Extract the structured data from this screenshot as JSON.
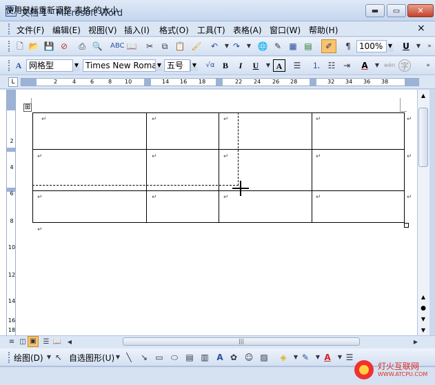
{
  "window": {
    "title": "文档 1 - Microsoft Word",
    "icon_name": "word-document-icon",
    "minimize_glyph": "▬",
    "maximize_glyph": "▭",
    "close_glyph": "✕"
  },
  "menu": {
    "items": [
      "文件(F)",
      "编辑(E)",
      "视图(V)",
      "插入(I)",
      "格式(O)",
      "工具(T)",
      "表格(A)",
      "窗口(W)",
      "帮助(H)"
    ],
    "close_glyph": "×"
  },
  "standard_toolbar": {
    "zoom_value": "100%",
    "underline_label": "U"
  },
  "format_toolbar": {
    "style_value": "网格型",
    "font_value": "Times New Roma",
    "size_value": "五号",
    "bold": "B",
    "italic": "I",
    "underline": "U",
    "char_border": "A",
    "font_color": "A",
    "phonetic": "wén",
    "enclose": "字"
  },
  "ruler": {
    "ticks": [
      "2",
      "4",
      "6",
      "8",
      "10",
      "14",
      "16",
      "18",
      "22",
      "24",
      "26",
      "28",
      "32",
      "34",
      "36",
      "38"
    ],
    "vticks": [
      "2",
      "4",
      "6",
      "8",
      "10",
      "12",
      "14",
      "16",
      "18"
    ]
  },
  "document": {
    "cell_mark": "↵",
    "paragraph_mark": "↵",
    "table_move_handle": "⊞"
  },
  "draw_toolbar": {
    "draw_label": "绘图(D)",
    "autoshape_label": "自选图形(U)"
  },
  "status": {
    "text": "使用鼠标重新调整 表格 的大小"
  },
  "watermark": {
    "text_top": "灯火互联网",
    "text_bottom": "WWW.ATCPU.COM"
  },
  "colors": {
    "accent": "#c5412c",
    "font_color_red": "#d42020",
    "highlight_yellow": "#f5e000"
  }
}
